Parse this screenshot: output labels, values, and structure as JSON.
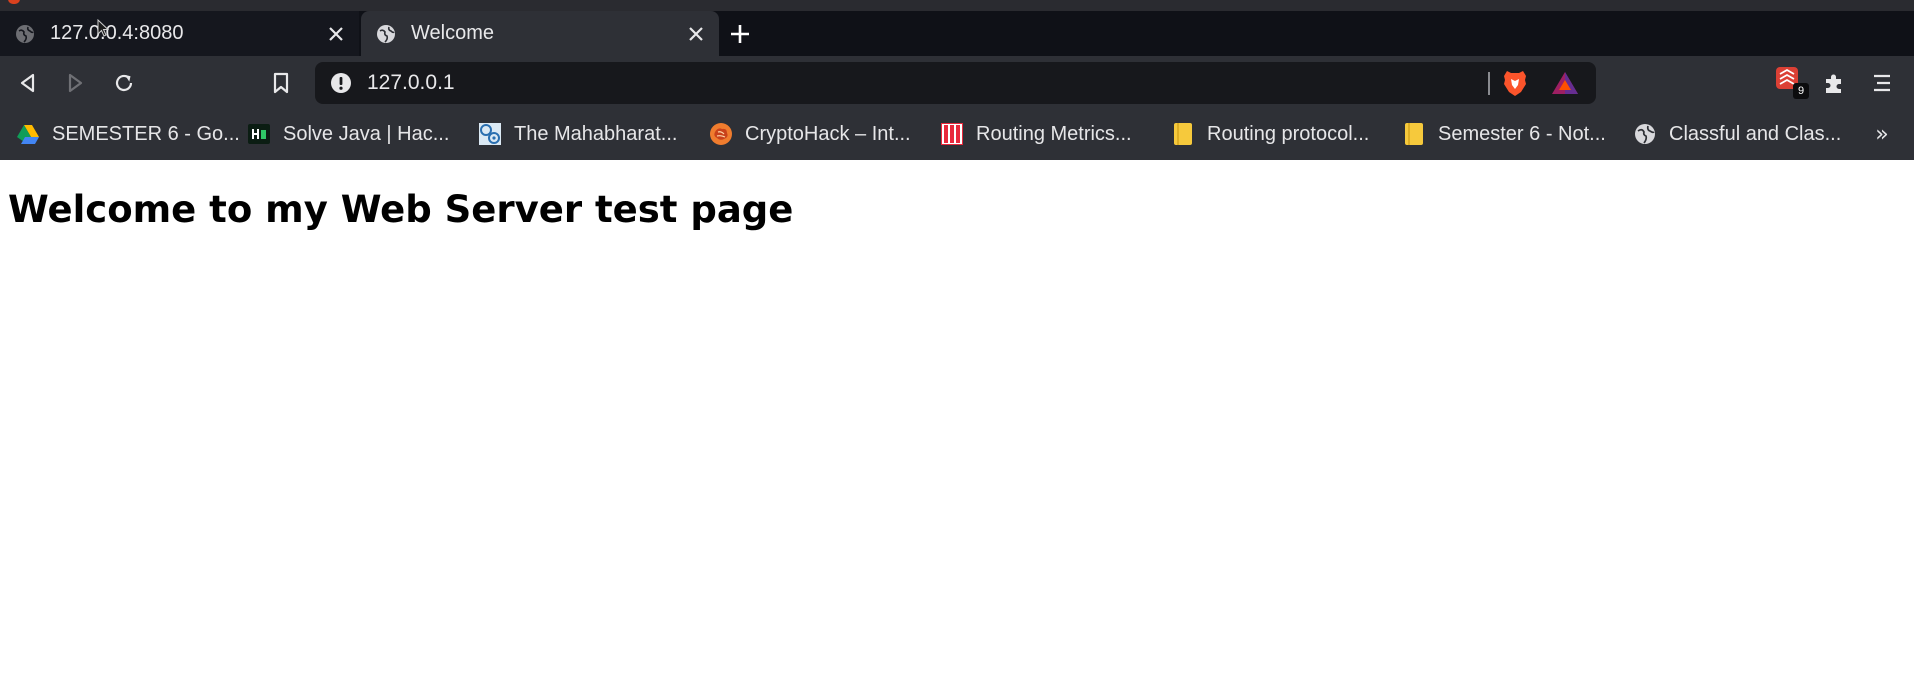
{
  "browser": {
    "tabs": [
      {
        "title": "127.0.0.4:8080",
        "favicon": "globe-icon",
        "active": false
      },
      {
        "title": "Welcome",
        "favicon": "globe-icon",
        "active": true
      }
    ],
    "address_bar": {
      "url": "127.0.0.1",
      "security_icon": "not-secure-info-icon"
    },
    "extensions": {
      "todoist_badge": "9"
    },
    "bookmarks": [
      {
        "label": "SEMESTER 6 - Go...",
        "icon": "google-drive-icon"
      },
      {
        "label": "Solve Java | Hac...",
        "icon": "hackerrank-icon"
      },
      {
        "label": "The Mahabharat...",
        "icon": "mahabharata-icon"
      },
      {
        "label": "CryptoHack – Int...",
        "icon": "cryptohack-icon"
      },
      {
        "label": "Routing Metrics...",
        "icon": "routing-metrics-icon"
      },
      {
        "label": "Routing protocol...",
        "icon": "notes-icon"
      },
      {
        "label": "Semester 6 - Not...",
        "icon": "notes-icon"
      },
      {
        "label": "Classful and Clas...",
        "icon": "globe-icon"
      }
    ],
    "colors": {
      "tabbar": "#0f1117",
      "toolbar": "#2e3036",
      "omnibox": "#17181c",
      "brave_orange": "#fb542b"
    }
  },
  "page": {
    "heading": "Welcome to my Web Server test page"
  }
}
